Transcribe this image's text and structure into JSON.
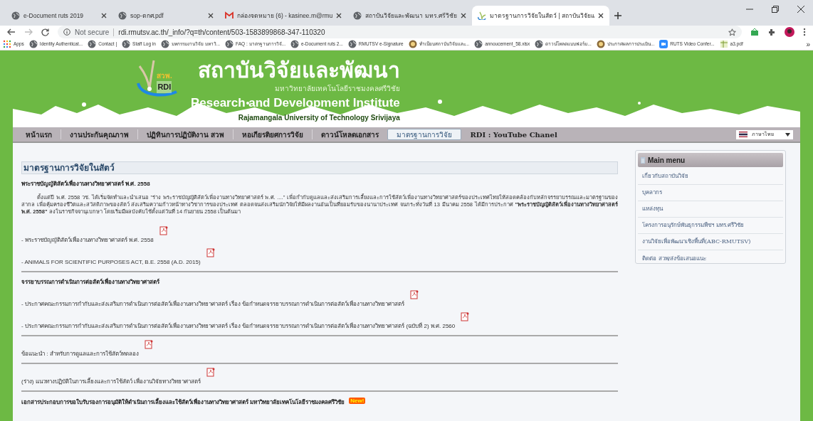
{
  "browser": {
    "tabs": [
      {
        "title": "e-Document ruts 2019",
        "kind": "globe",
        "selected": false
      },
      {
        "title": "sop-ตกศ.pdf",
        "kind": "globe",
        "selected": false
      },
      {
        "title": "กล่องจดหมาย (6) - kasinee.m@rmu",
        "kind": "mail",
        "selected": false
      },
      {
        "title": "สถาบันวิจัยและพัฒนา มทร.ศรีวิชัย",
        "kind": "globe",
        "selected": false
      },
      {
        "title": "มาตรฐานการวิจัยในสัตว์ | สถาบันวิจัยแ",
        "kind": "sprout",
        "selected": true
      }
    ],
    "security": "Not secure",
    "url": "rdi.rmutsv.ac.th/_info/?q=th/content/503-1583899868-347-110320",
    "bookmarks": [
      {
        "label": "Apps",
        "kind": "apps"
      },
      {
        "label": "Identity Authenticat...",
        "kind": "globe"
      },
      {
        "label": "Contact |",
        "kind": "globe"
      },
      {
        "label": "Staff Log in",
        "kind": "globe"
      },
      {
        "label": "มหกรรมงานวิจัย มหาวิ...",
        "kind": "globe"
      },
      {
        "label": "FAQ : มาตรฐานการวิจั...",
        "kind": "globe"
      },
      {
        "label": "e-Document ruts 2...",
        "kind": "globe"
      },
      {
        "label": "RMUTSV e-Signature",
        "kind": "globe"
      },
      {
        "label": "ทำเนียบสถาบันวิจัยและ...",
        "kind": "seal"
      },
      {
        "label": "annoucement_58.xlsx",
        "kind": "globe"
      },
      {
        "label": "ดาวน์โหลดแบบฟอร์ม...",
        "kind": "globe"
      },
      {
        "label": "ประกาศผลการประเมิน...",
        "kind": "seal"
      },
      {
        "label": "RUTS Video Confer...",
        "kind": "video"
      },
      {
        "label": "a3.pdf",
        "kind": "sheet"
      }
    ],
    "more": "»"
  },
  "header": {
    "logo_th": "สวพ.",
    "logo_en": "RDI",
    "title": "สถาบันวิจัยและพัฒนา",
    "subtitle": "มหาวิทยาลัยเทคโนโลยีราชมงคลศรีวิชัย",
    "title_en": "Research and Development Institute",
    "subtitle_en": "Rajamangala University of Technology Srivijaya"
  },
  "nav": {
    "items": [
      {
        "label": "หน้าแรก",
        "selected": false
      },
      {
        "label": "งานประกันคุณภาพ",
        "selected": false
      },
      {
        "label": "ปฏิทินการปฏิบัติงาน สวพ",
        "selected": false
      },
      {
        "label": "หอเกียรติยศการวิจัย",
        "selected": false
      },
      {
        "label": "ดาวน์โหลดเอกสาร",
        "selected": false
      },
      {
        "label": "มาตรฐานการวิจัย",
        "selected": true
      },
      {
        "label": "RDI : YouTube Chanel",
        "selected": false
      }
    ],
    "language": "ภาษาไทย"
  },
  "content": {
    "heading": "มาตรฐานการวิจัยในสัตว์",
    "blocks": [
      {
        "kind": "title",
        "text": "พระราชบัญญัติสัตว์เพื่องานทางวิทยาศาสตร์ พ.ศ. 2558"
      },
      {
        "kind": "paragraph",
        "text": "ตั้งแต่ปี พ.ศ. 2558 วช. ได้เริ่มจัดทำและนำเสนอ \"ร่าง พระราชบัญญัติสัตว์เพื่องานทางวิทยาศาสตร์ พ.ศ. ....\" เพื่อกำกับดูแลและส่งเสริมการเลี้ยงและการใช้สัตว์เพื่องานทางวิทยาศาสตร์ของประเทศไทยให้สอดคล้องกับหลักจรรยาบรรณและมาตรฐานของสากล เพื่อคุ้มครองชีวิตและสวัสดิภาพของสัตว์ ส่งเสริมความก้าวหน้าทางวิชาการของประเทศ ตลอดจนส่งเสริมนักวิจัยให้มีผลงานอันเป็นที่ยอมรับของนานาประเทศ จนกระทั่งวันที่ 13 มีนาคม 2558 ได้มีการประกาศ **\"พระราชบัญญัติสัตว์เพื่องานทางวิทยาศาสตร์ พ.ศ. 2558\"** ลงในราชกิจจานุเบกษา โดยเริ่มมีผลบังคับใช้ตั้งแต่วันที่ 14 กันยายน 2558 เป็นต้นมา"
      },
      {
        "kind": "document",
        "text": "- พระราชบัญญัติสัตว์เพื่องานทางวิทยาศาสตร์ พ.ศ. 2558"
      },
      {
        "kind": "document",
        "text": "- ANIMALS FOR SCIENTIFIC PURPOSES ACT, B.E. 2558 (A.D. 2015)"
      },
      {
        "kind": "divider"
      },
      {
        "kind": "title",
        "text": "จรรยาบรรณการดำเนินการต่อสัตว์เพื่องานทางวิทยาศาสตร์"
      },
      {
        "kind": "document",
        "text": "- ประกาศคณะกรรมการกำกับและส่งเสริมการดำเนินการต่อสัตว์เพื่องานทางวิทยาศาสตร์ เรื่อง ข้อกำหนดจรรยาบรรณการดำเนินการต่อสัตว์เพื่องานทางวิทยาศาสตร์"
      },
      {
        "kind": "document",
        "text": "- ประกาศคณะกรรมการกำกับและส่งเสริมการดำเนินการต่อสัตว์เพื่องานทางวิทยาศาสตร์ เรื่อง ข้อกำหนดจรรยาบรรณการดำเนินการต่อสัตว์เพื่องานทางวิทยาศาสตร์ (ฉบับที่ 2) พ.ศ. 2560"
      },
      {
        "kind": "divider"
      },
      {
        "kind": "document",
        "text": "ข้อแนะนำ : สำหรับการดูแลและการใช้สัตว์ทดลอง"
      },
      {
        "kind": "divider"
      },
      {
        "kind": "document",
        "text": "(ร่าง) แนวทางปฏิบัติในการเลี้ยงและการใช้สัตว์ เพื่องานวิจัยทางวิทยาศาสตร์"
      },
      {
        "kind": "divider"
      },
      {
        "kind": "title",
        "text": "เอกสารประกอบการขอใบรับรองการอนุมัติให้ดำเนินการเลี้ยงและใช้สัตว์เพื่องานทางวิทยาศาสตร์ มหาวิทยาลัยเทคโนโลยีราชมงคลศรีวิชัย",
        "badge": "New!"
      }
    ]
  },
  "sidebar": {
    "title": "Main menu",
    "items": [
      "เกี่ยวกับสถาบันวิจัย",
      "บุคลากร",
      "แหล่งทุน",
      "โครงการอนุรักษ์พันธุกรรมพืชฯ มทร.ศรีวิชัย",
      "งานวิจัยเพื่อพัฒนาเชิงพื้นที่(ABC-RMUTSV)",
      "ติดต่อ สวพ/ส่งข้อเสนอแนะ"
    ]
  }
}
